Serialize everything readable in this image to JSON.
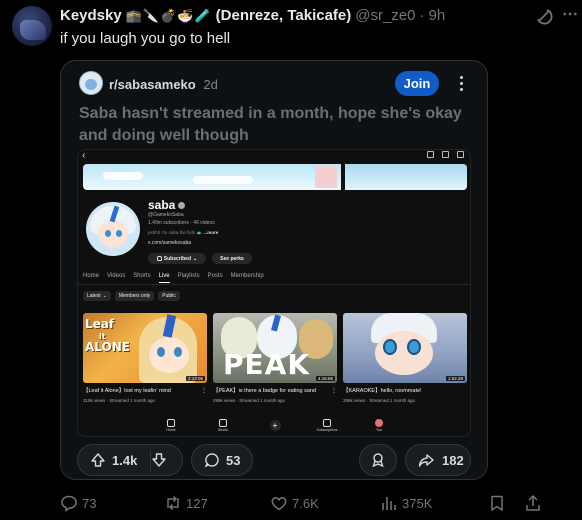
{
  "tweet": {
    "author_name": "Keydsky",
    "author_emojis": "🕋🔪💣🍜🧪",
    "author_suffix": "(Denreze, Takicafe)",
    "handle": "@sr_ze0",
    "separator": "·",
    "time": "9h",
    "text": "if you laugh you go to hell"
  },
  "reddit_card": {
    "subreddit": "r/sabasameko",
    "age": "2d",
    "join_label": "Join",
    "post_title": "Saba hasn't streamed in a month, hope she's okay and doing well though",
    "upvotes": "1.4k",
    "comments": "53",
    "shares": "182"
  },
  "youtube": {
    "channel_name": "saba",
    "channel_handle": "@GamekoSaba",
    "stats": "1.49m subscribers · 46 videos",
    "description_prefix": "pshhh I'm saba the fish! 🐟 ",
    "description_more": "...more",
    "link": "x.com/samekosaba",
    "subscribed_label": "Subscribed",
    "perks_label": "See perks",
    "tabs": [
      "Home",
      "Videos",
      "Shorts",
      "Live",
      "Playlists",
      "Posts",
      "Membership"
    ],
    "active_tab": "Live",
    "chips": [
      "Latest",
      "Members only",
      "Public"
    ],
    "videos": [
      {
        "title": "【Leaf it Alone】lost my leafin' mind",
        "meta": "319k views · Streamed 1 month ago",
        "duration": "2:13:06",
        "thumb_text_1": "Leaf",
        "thumb_text_2": "it",
        "thumb_text_3": "ALONE"
      },
      {
        "title": "【PEAK】is there a badge for eating sand",
        "meta": "299k views · Streamed 1 month ago",
        "duration": "4:15:56",
        "thumb_text": "PEAK"
      },
      {
        "title": "【KARAOKE】hello, roommate!",
        "meta": "286k views · Streamed 1 month ago",
        "duration": "1:52:28"
      }
    ],
    "nav": [
      "Home",
      "Shorts",
      "",
      "Subscriptions",
      "You"
    ]
  },
  "footer": {
    "replies": "73",
    "retweets": "127",
    "likes": "7.6K",
    "views": "375K"
  },
  "colors": {
    "join_blue": "#115bca",
    "background": "#000000",
    "muted": "#71767b"
  }
}
